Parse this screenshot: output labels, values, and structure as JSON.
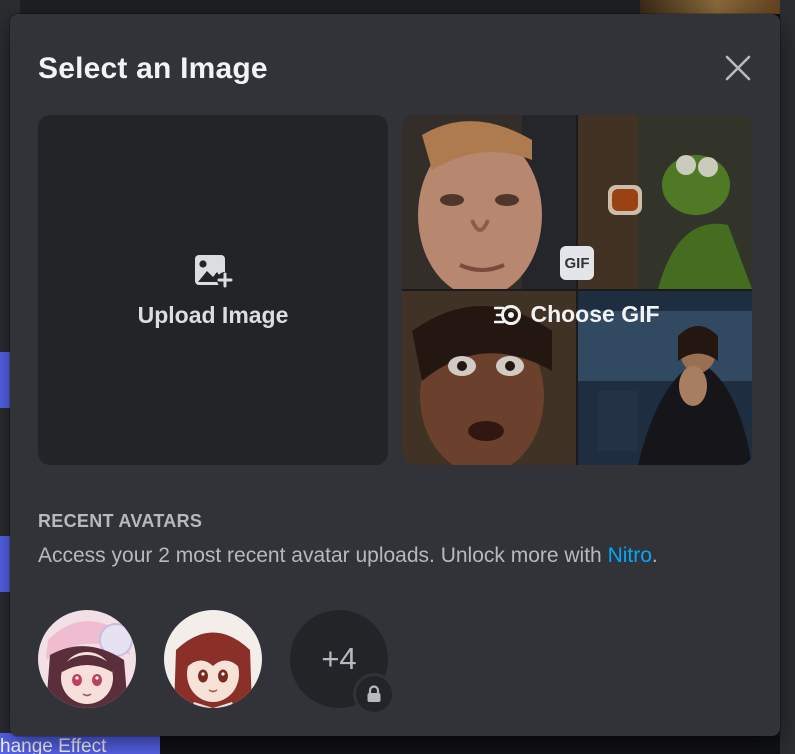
{
  "modal": {
    "title": "Select an Image",
    "close_label": "close"
  },
  "options": {
    "upload_label": "Upload Image",
    "gif_label": "Choose GIF",
    "gif_badge": "GIF"
  },
  "recent": {
    "title": "RECENT AVATARS",
    "description": "Access your 2 most recent avatar uploads. Unlock more with ",
    "nitro_link": "Nitro",
    "description_end": ".",
    "more_count": "+4"
  },
  "background": {
    "bottom_button": "hange Effect"
  },
  "colors": {
    "modal_bg": "#313338",
    "tile_bg": "#232428",
    "link": "#00a8fc",
    "title_text": "#f2f3f5",
    "muted_text": "#b5bac1"
  },
  "icons": [
    "image-plus-icon",
    "gif-picker-icon",
    "close-icon",
    "lock-icon"
  ]
}
